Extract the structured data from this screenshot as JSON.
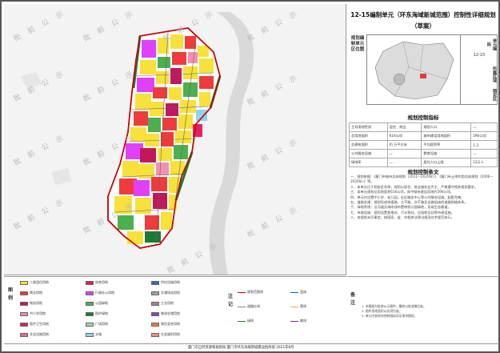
{
  "title": {
    "line1": "12-15编制单元（环东海域新城范围）控制性详细规划",
    "line2": "（草案）"
  },
  "watermark": "批 前 公 示",
  "location_map": {
    "label": "规划编制单元区位图",
    "unit_label": "单元编码",
    "unit_code": "12-15",
    "district_label": "所属区域",
    "district": "翔安区"
  },
  "indicators": {
    "section_title": "规划控制指标",
    "rows": [
      [
        "主导用地性质",
        "居住、商业",
        "规划人口",
        "—"
      ],
      [
        "总用地面积",
        "616公顷",
        "城市建设用地面积",
        "596公顷"
      ],
      [
        "总建筑面积",
        "约 万平方米",
        "平均容积率",
        "1.3"
      ],
      [
        "公共服务设施",
        "—",
        "教育设施",
        "—"
      ],
      [
        "绿地率",
        "—",
        "居住人口上限",
        "12万人"
      ]
    ]
  },
  "clauses": {
    "section_title": "规划控制条文",
    "text": [
      "一、规划依据：《厦门市城市总体规划（2011—2020年）》、《厦门市土地利用总体规划（2006—2020年）》等。",
      "二、本单元位于翔安区东侧，规划以居住、商业服务业为主，严格遵守相关规划要求。",
      "三、本单元规划总用地面积616公顷，其中城市建设用地约596公顷。",
      "四、单元内设置中小学、幼儿园、社区服务中心等公共服务设施，配套完善。",
      "五、道路交通：规划形成快速路、主干路、次干路及支路组成的道路网络体系。",
      "六、绿地系统：沿河道及海岸线布置带状公园绿地，形成生态廊道。",
      "七、市政设施：规划设置变电站、污水泵站、垃圾转运站等市政设施。",
      "八、本规划未尽事宜，按国家、省、市相关法律法规及技术规范执行。"
    ]
  },
  "legend": {
    "title": "图例",
    "items": [
      {
        "label": "二类居住用地",
        "color": "#f7e13a"
      },
      {
        "label": "商业用地",
        "color": "#ef3b3b"
      },
      {
        "label": "商务用地",
        "color": "#c2185b"
      },
      {
        "label": "中小学用地",
        "color": "#f48fb1"
      },
      {
        "label": "医疗卫生用地",
        "color": "#e91e63"
      },
      {
        "label": "文化设施用地",
        "color": "#f06292"
      },
      {
        "label": "体育用地",
        "color": "#d81b60"
      },
      {
        "label": "行政办公用地",
        "color": "#e040fb"
      },
      {
        "label": "公园绿地",
        "color": "#4caf50"
      },
      {
        "label": "防护绿地",
        "color": "#1b7a35"
      },
      {
        "label": "广场用地",
        "color": "#a5d6a7"
      },
      {
        "label": "水域",
        "color": "#8ed3f0"
      },
      {
        "label": "供应设施用地",
        "color": "#2e6eb5"
      },
      {
        "label": "交通场站用地",
        "color": "#9e9e9e"
      },
      {
        "label": "工业用地",
        "color": "#a1887f"
      },
      {
        "label": "物流仓储用地",
        "color": "#8e44ad"
      },
      {
        "label": "商住混合用地",
        "color": "#ff7043"
      },
      {
        "label": "社会福利用地",
        "color": "#ff8a80"
      }
    ],
    "title2": "注记",
    "lines": [
      {
        "label": "规划范围线",
        "color": "#cc0000"
      },
      {
        "label": "道路红线",
        "color": "#888888"
      },
      {
        "label": "绿线",
        "color": "#2e7d32"
      },
      {
        "label": "蓝线",
        "color": "#1565c0"
      },
      {
        "label": "黄线",
        "color": "#f9a825"
      },
      {
        "label": "紫线",
        "color": "#8e24aa"
      }
    ]
  },
  "notes": {
    "title": "备注",
    "text": [
      "1. 本图纸为批前公示图件，最终以批准稿为准。",
      "2. 图中用地面积以实测为准。",
      "3. 单元内各地块控制指标详见地块图则。"
    ]
  },
  "footer": "厦门市自然资源和规划局 厦门市环东海域新城建设指挥部 2021年8月"
}
